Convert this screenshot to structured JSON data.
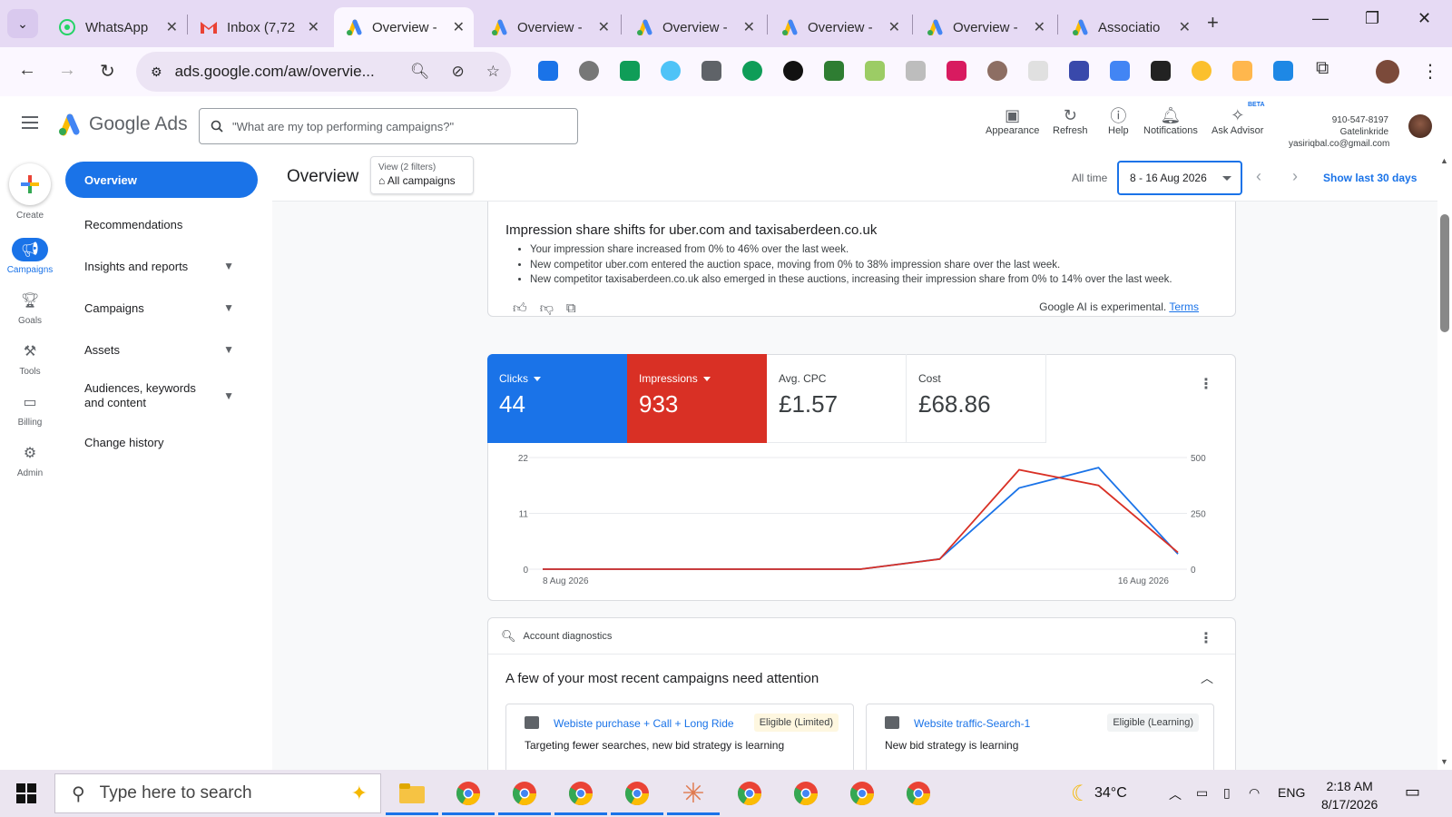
{
  "browser": {
    "tabs": [
      {
        "title": "WhatsApp",
        "active": false
      },
      {
        "title": "Inbox (7,72",
        "active": false
      },
      {
        "title": "Overview -",
        "active": true
      },
      {
        "title": "Overview -",
        "active": false
      },
      {
        "title": "Overview -",
        "active": false
      },
      {
        "title": "Overview -",
        "active": false
      },
      {
        "title": "Overview -",
        "active": false
      },
      {
        "title": "Associatio",
        "active": false
      }
    ],
    "url": "ads.google.com/aw/overvie..."
  },
  "ads_header": {
    "product": "Google Ads",
    "search_placeholder": "\"What are my top performing campaigns?\"",
    "buttons": {
      "appearance": "Appearance",
      "refresh": "Refresh",
      "help": "Help",
      "notifications": "Notifications",
      "ask_advisor": "Ask Advisor",
      "beta": "BETA"
    },
    "account_id": "910-547-8197 Gatelinkride",
    "account_email": "yasiriqbal.co@gmail.com"
  },
  "rail": {
    "create": "Create",
    "campaigns": "Campaigns",
    "goals": "Goals",
    "tools": "Tools",
    "billing": "Billing",
    "admin": "Admin"
  },
  "sidenav": {
    "overview": "Overview",
    "recommendations": "Recommendations",
    "insights": "Insights and reports",
    "campaigns": "Campaigns",
    "assets": "Assets",
    "audiences": "Audiences, keywords and content",
    "change_history": "Change history"
  },
  "titlebar": {
    "title": "Overview",
    "view_label": "View (2 filters)",
    "view_value": "All campaigns",
    "all_time": "All time",
    "date_range": "8 - 16 Aug 2026",
    "show_last": "Show last 30 days"
  },
  "insight": {
    "heading": "Impression share shifts for uber.com and taxisaberdeen.co.uk",
    "bullets": [
      "Your impression share increased from 0% to 46% over the last week.",
      "New competitor uber.com entered the auction space, moving from 0% to 38% impression share over the last week.",
      "New competitor taxisaberdeen.co.uk also emerged in these auctions, increasing their impression share from 0% to 14% over the last week."
    ],
    "experimental": "Google AI is experimental.",
    "terms": "Terms"
  },
  "metrics": {
    "clicks_label": "Clicks",
    "clicks_value": "44",
    "impressions_label": "Impressions",
    "impressions_value": "933",
    "cpc_label": "Avg. CPC",
    "cpc_value": "£1.57",
    "cost_label": "Cost",
    "cost_value": "£68.86"
  },
  "chart_data": {
    "type": "line",
    "x": [
      "8 Aug 2026",
      "9 Aug 2026",
      "10 Aug 2026",
      "11 Aug 2026",
      "12 Aug 2026",
      "13 Aug 2026",
      "14 Aug 2026",
      "15 Aug 2026",
      "16 Aug 2026"
    ],
    "x_tick_labels": [
      "8 Aug 2026",
      "16 Aug 2026"
    ],
    "series": [
      {
        "name": "Clicks",
        "axis": "left",
        "color": "#1a73e8",
        "values": [
          0,
          0,
          0,
          0,
          0,
          2,
          16,
          20,
          3
        ]
      },
      {
        "name": "Impressions",
        "axis": "right",
        "color": "#d93025",
        "values": [
          0,
          0,
          0,
          0,
          0,
          45,
          445,
          375,
          75
        ]
      }
    ],
    "y_left": {
      "ticks": [
        "0",
        "11",
        "22"
      ],
      "range": [
        0,
        22
      ]
    },
    "y_right": {
      "ticks": [
        "0",
        "250",
        "500"
      ],
      "range": [
        0,
        500
      ]
    },
    "grid": true
  },
  "diagnostics": {
    "header": "Account diagnostics",
    "title": "A few of your most recent campaigns need attention",
    "campaigns": [
      {
        "name": "Webiste purchase + Call + Long Ride",
        "status": "Eligible (Limited)",
        "detail": "Targeting fewer searches, new bid strategy is learning"
      },
      {
        "name": "Website traffic-Search-1",
        "status": "Eligible (Learning)",
        "detail": "New bid strategy is learning"
      }
    ]
  },
  "taskbar": {
    "search_placeholder": "Type here to search",
    "temperature": "34°C",
    "language": "ENG",
    "time": "2:18 AM",
    "date": "8/17/2026"
  }
}
